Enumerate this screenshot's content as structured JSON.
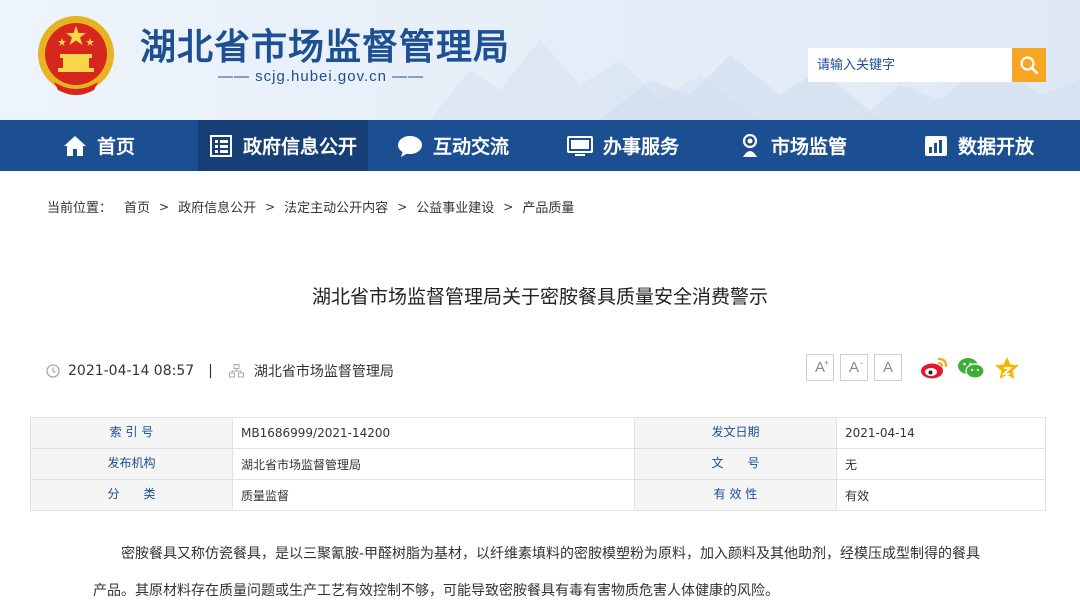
{
  "header": {
    "site_title": "湖北省市场监督管理局",
    "site_domain": "scjg.hubei.gov.cn",
    "search": {
      "placeholder": "请输入关键字"
    }
  },
  "nav": {
    "items": [
      {
        "label": "首页",
        "icon": "home-icon"
      },
      {
        "label": "政府信息公开",
        "icon": "document-list-icon",
        "active": true
      },
      {
        "label": "互动交流",
        "icon": "chat-bubble-icon"
      },
      {
        "label": "办事服务",
        "icon": "monitor-icon"
      },
      {
        "label": "市场监管",
        "icon": "inspector-icon"
      },
      {
        "label": "数据开放",
        "icon": "bar-chart-icon"
      }
    ]
  },
  "breadcrumb": {
    "prefix": "当前位置：",
    "items": [
      "首页",
      "政府信息公开",
      "法定主动公开内容",
      "公益事业建设",
      "产品质量"
    ],
    "separator": ">"
  },
  "article": {
    "title": "湖北省市场监督管理局关于密胺餐具质量安全消费警示",
    "datetime": "2021-04-14 08:57",
    "source": "湖北省市场监督管理局",
    "font_buttons": [
      "A+",
      "A-",
      "A"
    ],
    "share_icons": [
      "weibo-icon",
      "wechat-icon",
      "favorite-icon"
    ],
    "body": "密胺餐具又称仿瓷餐具，是以三聚氰胺-甲醛树脂为基材，以纤维素填料的密胺模塑粉为原料，加入颜料及其他助剂，经模压成型制得的餐具产品。其原材料存在质量问题或生产工艺有效控制不够，可能导致密胺餐具有毒有害物质危害人体健康的风险。"
  },
  "info_table": {
    "rows": [
      {
        "label1": "索 引 号",
        "value1": "MB1686999/2021-14200",
        "label2": "发文日期",
        "value2": "2021-04-14"
      },
      {
        "label1": "发布机构",
        "value1": "湖北省市场监督管理局",
        "label2": "文　　号",
        "value2": "无"
      },
      {
        "label1": "分　　类",
        "value1": "质量监督",
        "label2": "有 效 性",
        "value2": "有效"
      }
    ]
  },
  "colors": {
    "brand_blue": "#1c4e92",
    "nav_active": "#173f77",
    "search_button": "#f5a623"
  }
}
